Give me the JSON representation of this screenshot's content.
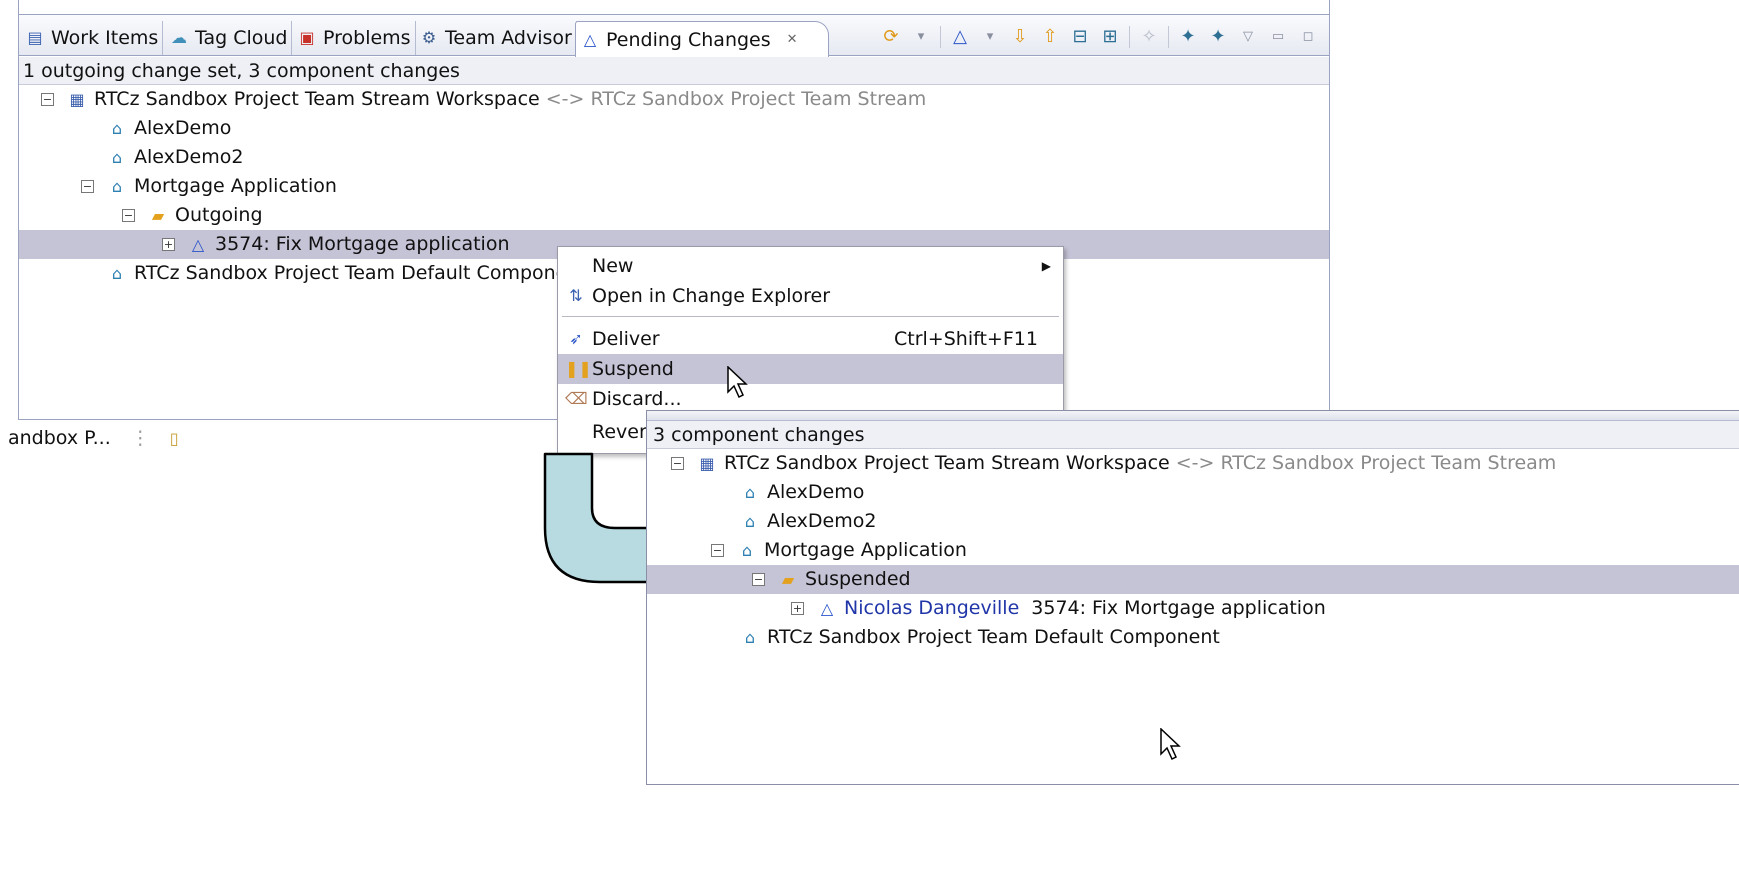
{
  "top_view": {
    "tabs": [
      {
        "label": "Work Items",
        "icon": "work-items-icon"
      },
      {
        "label": "Tag Cloud",
        "icon": "tag-cloud-icon"
      },
      {
        "label": "Problems",
        "icon": "problems-icon"
      },
      {
        "label": "Team Advisor",
        "icon": "team-advisor-icon"
      },
      {
        "label": "Pending Changes",
        "icon": "pending-changes-icon",
        "active": true
      }
    ],
    "status": "1 outgoing change set, 3 component changes",
    "tree": {
      "workspace": "RTCz Sandbox Project Team Stream Workspace",
      "stream_suffix": "<-> RTCz Sandbox Project Team Stream",
      "components": [
        "AlexDemo",
        "AlexDemo2",
        "Mortgage Application"
      ],
      "folder": "Outgoing",
      "change_set": "3574: Fix Mortgage application",
      "default_component": "RTCz Sandbox Project Team Default Component"
    },
    "bottom_strip_label": "andbox P..."
  },
  "context_menu": {
    "items": [
      {
        "label": "New",
        "icon": "",
        "has_submenu": true
      },
      {
        "label": "Open in Change Explorer",
        "icon": "change-explorer-icon"
      },
      {
        "label": "Deliver",
        "icon": "deliver-icon",
        "accelerator": "Ctrl+Shift+F11"
      },
      {
        "label": "Suspend",
        "icon": "suspend-icon",
        "highlighted": true
      },
      {
        "label": "Discard...",
        "icon": "discard-icon"
      },
      {
        "label": "Revers",
        "icon": ""
      }
    ]
  },
  "bottom_view": {
    "status": "3 component changes",
    "tree": {
      "workspace": "RTCz Sandbox Project Team Stream Workspace",
      "stream_suffix": "<-> RTCz Sandbox Project Team Stream",
      "components": [
        "AlexDemo",
        "AlexDemo2",
        "Mortgage Application"
      ],
      "folder": "Suspended",
      "author": "Nicolas Dangeville",
      "change_set": "3574: Fix Mortgage application",
      "default_component": "RTCz Sandbox Project Team Default Component"
    }
  },
  "colors": {
    "selection": "#c5c3d6",
    "arrow_fill": "#b7dbe0",
    "author_link": "#1f35a8",
    "muted_text": "#8a8a8a"
  }
}
